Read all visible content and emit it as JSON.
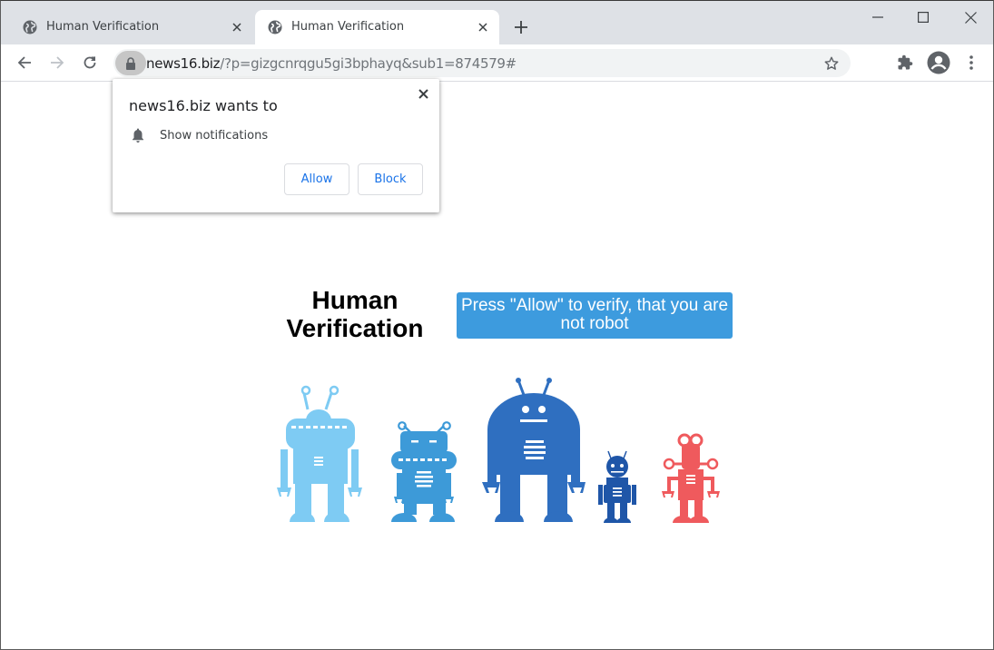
{
  "browser": {
    "tabs": [
      {
        "title": "Human Verification",
        "active": false,
        "icon": "globe-icon"
      },
      {
        "title": "Human Verification",
        "active": true,
        "icon": "globe-icon"
      }
    ],
    "new_tab_icon": "plus-icon",
    "window_controls": [
      "minimize-icon",
      "maximize-icon",
      "close-icon"
    ],
    "address": {
      "host": "news16.biz",
      "path": "/?p=gizgcnrqgu5gi3bphayq&sub1=874579#",
      "security_icon": "lock-icon"
    },
    "toolbar_icons": [
      "back-icon",
      "forward-icon",
      "reload-icon",
      "star-icon",
      "extensions-icon",
      "profile-icon",
      "menu-icon"
    ]
  },
  "permission_popup": {
    "title": "news16.biz wants to",
    "permission": "Show notifications",
    "permission_icon": "bell-icon",
    "allow_label": "Allow",
    "block_label": "Block"
  },
  "page": {
    "heading": "Human Verification",
    "banner_text": "Press \"Allow\" to verify, that you are not robot",
    "robot_colors": [
      "#7ecbf3",
      "#3d9ad8",
      "#2f6fc0",
      "#1f56a8",
      "#ef5a5d"
    ]
  }
}
